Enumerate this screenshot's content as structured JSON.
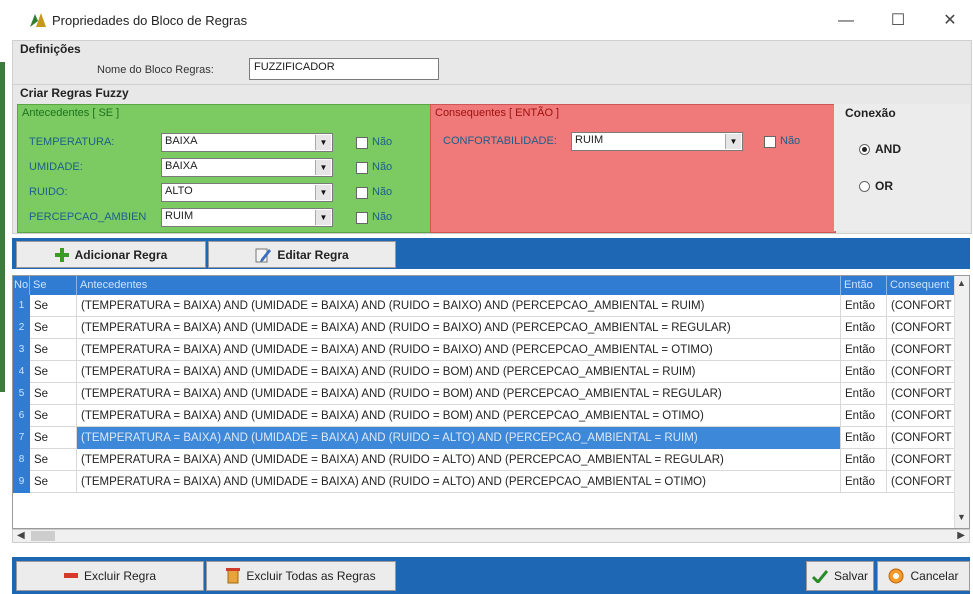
{
  "window": {
    "title": "Propriedades do Bloco de Regras",
    "minimize": "—",
    "maximize": "☐",
    "close": "✕"
  },
  "definicoes": {
    "legend": "Definições",
    "name_label": "Nome do Bloco Regras:",
    "name_value": "FUZZIFICADOR"
  },
  "criar": {
    "legend": "Criar Regras Fuzzy",
    "antecedentes": {
      "title": "Antecedentes [ SE ]",
      "rows": [
        {
          "label": "TEMPERATURA:",
          "value": "BAIXA",
          "check": "Não"
        },
        {
          "label": "UMIDADE:",
          "value": "BAIXA",
          "check": "Não"
        },
        {
          "label": "RUIDO:",
          "value": "ALTO",
          "check": "Não"
        },
        {
          "label": "PERCEPCAO_AMBIEN",
          "value": "RUIM",
          "check": "Não"
        }
      ]
    },
    "consequentes": {
      "title": "Consequentes [ ENTÃO ]",
      "label": "CONFORTABILIDADE:",
      "value": "RUIM",
      "check": "Não"
    },
    "conexao": {
      "title": "Conexão",
      "and_label": "AND",
      "or_label": "OR",
      "selected": "AND"
    }
  },
  "toolbar": {
    "add": "Adicionar Regra",
    "edit": "Editar Regra"
  },
  "grid": {
    "headers": {
      "no": "No",
      "se": "Se",
      "antecedentes": "Antecedentes",
      "entao": "Então",
      "consequentes": "Consequent"
    },
    "rows": [
      {
        "no": "1",
        "se": "Se",
        "ant": "(TEMPERATURA = BAIXA) AND (UMIDADE = BAIXA) AND (RUIDO = BAIXO) AND (PERCEPCAO_AMBIENTAL = RUIM)",
        "entao": "Então",
        "cons": "(CONFORT"
      },
      {
        "no": "2",
        "se": "Se",
        "ant": "(TEMPERATURA = BAIXA) AND (UMIDADE = BAIXA) AND (RUIDO = BAIXO) AND (PERCEPCAO_AMBIENTAL = REGULAR)",
        "entao": "Então",
        "cons": "(CONFORT"
      },
      {
        "no": "3",
        "se": "Se",
        "ant": "(TEMPERATURA = BAIXA) AND (UMIDADE = BAIXA) AND (RUIDO = BAIXO) AND (PERCEPCAO_AMBIENTAL = OTIMO)",
        "entao": "Então",
        "cons": "(CONFORT"
      },
      {
        "no": "4",
        "se": "Se",
        "ant": "(TEMPERATURA = BAIXA) AND (UMIDADE = BAIXA) AND (RUIDO = BOM) AND (PERCEPCAO_AMBIENTAL = RUIM)",
        "entao": "Então",
        "cons": "(CONFORT"
      },
      {
        "no": "5",
        "se": "Se",
        "ant": "(TEMPERATURA = BAIXA) AND (UMIDADE = BAIXA) AND (RUIDO = BOM) AND (PERCEPCAO_AMBIENTAL = REGULAR)",
        "entao": "Então",
        "cons": "(CONFORT"
      },
      {
        "no": "6",
        "se": "Se",
        "ant": "(TEMPERATURA = BAIXA) AND (UMIDADE = BAIXA) AND (RUIDO = BOM) AND (PERCEPCAO_AMBIENTAL = OTIMO)",
        "entao": "Então",
        "cons": "(CONFORT"
      },
      {
        "no": "7",
        "se": "Se",
        "ant": "(TEMPERATURA = BAIXA) AND (UMIDADE = BAIXA) AND (RUIDO = ALTO) AND (PERCEPCAO_AMBIENTAL = RUIM)",
        "entao": "Então",
        "cons": "(CONFORT"
      },
      {
        "no": "8",
        "se": "Se",
        "ant": "(TEMPERATURA = BAIXA) AND (UMIDADE = BAIXA) AND (RUIDO = ALTO) AND (PERCEPCAO_AMBIENTAL = REGULAR)",
        "entao": "Então",
        "cons": "(CONFORT"
      },
      {
        "no": "9",
        "se": "Se",
        "ant": "(TEMPERATURA = BAIXA) AND (UMIDADE = BAIXA) AND (RUIDO = ALTO) AND (PERCEPCAO_AMBIENTAL = OTIMO)",
        "entao": "Então",
        "cons": "(CONFORT"
      }
    ],
    "selected_row": "7"
  },
  "bottom": {
    "delete": "Excluir Regra",
    "delete_all": "Excluir Todas as Regras",
    "save": "Salvar",
    "cancel": "Cancelar"
  },
  "colors": {
    "accent_blue": "#1d67b5",
    "antecedentes_green": "#7ccb62",
    "consequentes_red": "#f07a7a"
  }
}
